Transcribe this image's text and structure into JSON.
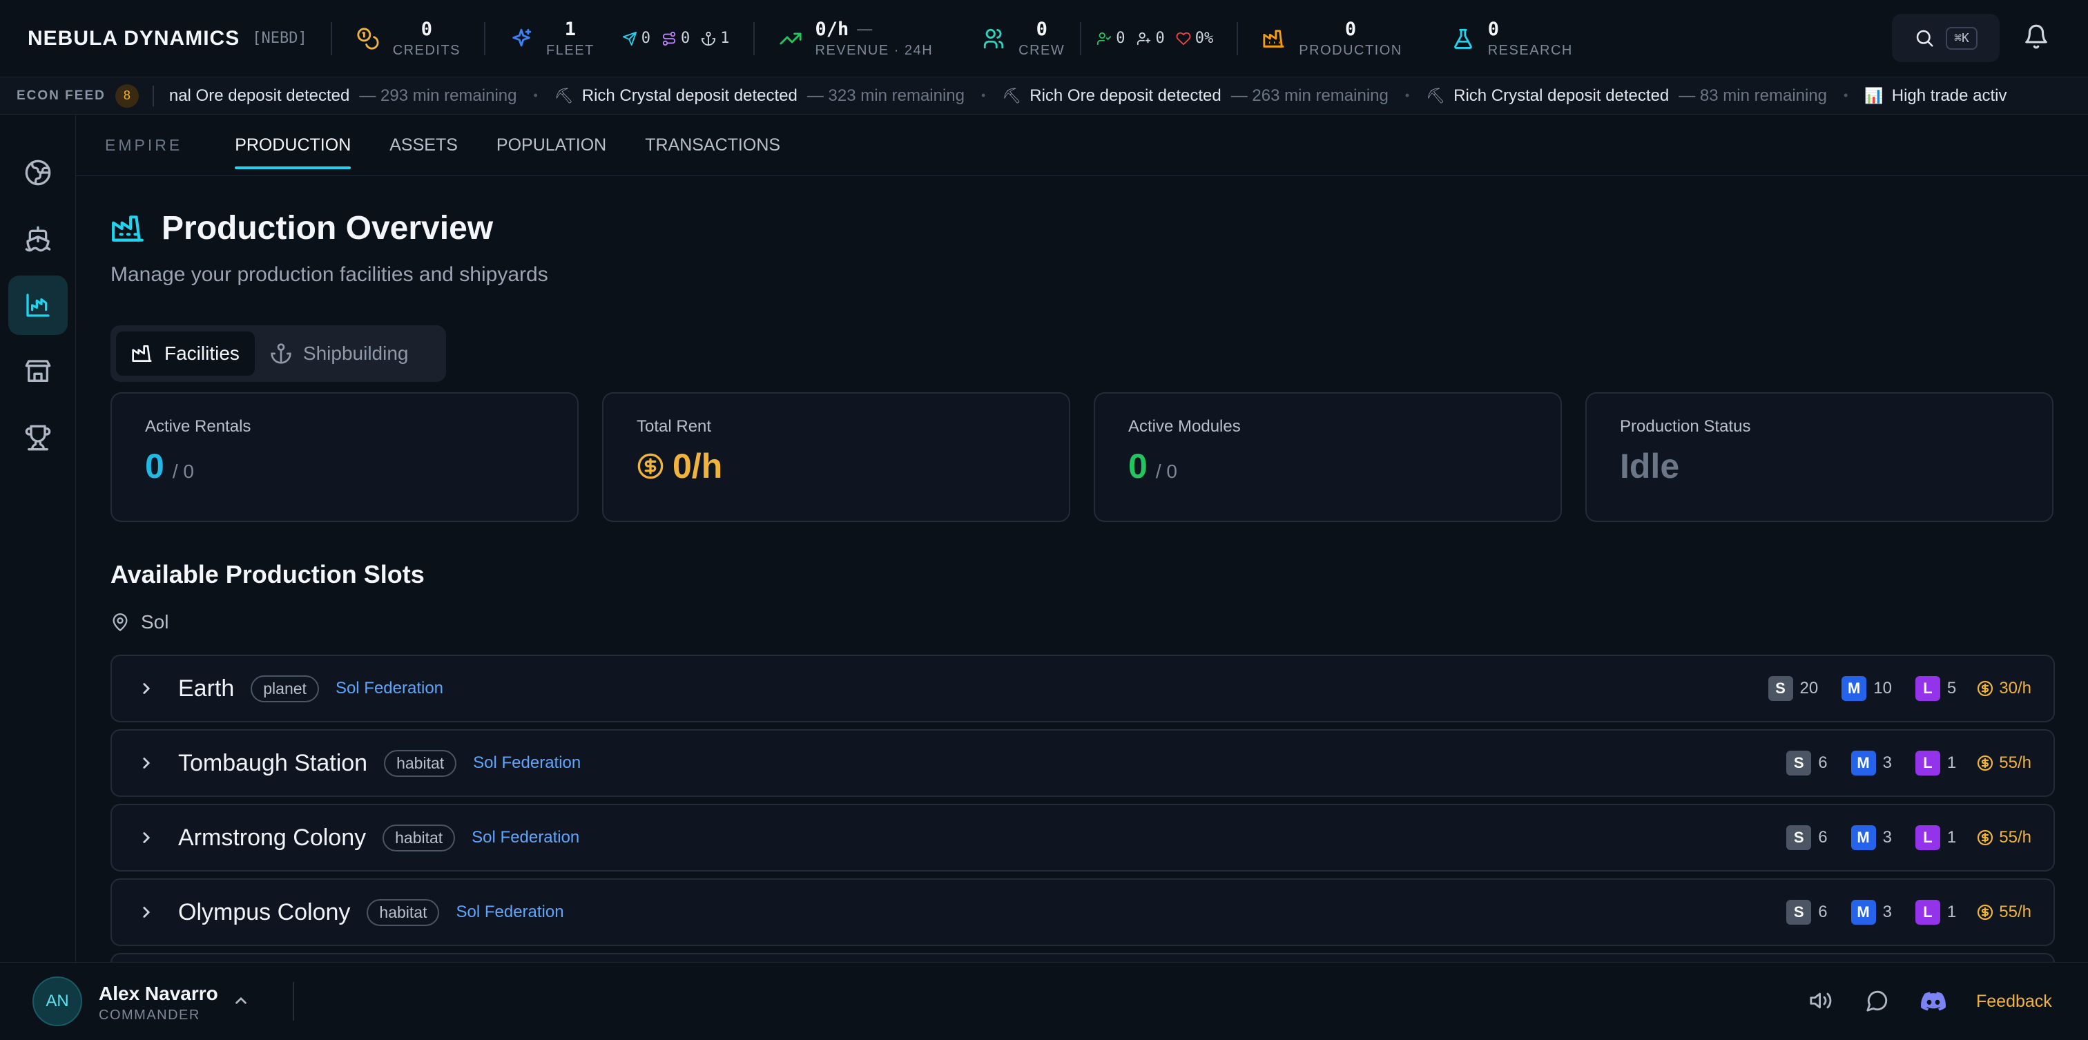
{
  "brand": {
    "name": "NEBULA DYNAMICS",
    "tag": "[NEBD]"
  },
  "stats": {
    "credits": {
      "value": "0",
      "label": "CREDITS"
    },
    "fleet": {
      "value": "1",
      "label": "FLEET"
    },
    "fleet_detail": {
      "ships_moving": "0",
      "routes": "0",
      "docked": "1"
    },
    "revenue": {
      "value": "0/h",
      "trend": "—",
      "label": "REVENUE · 24H"
    },
    "crew": {
      "value": "0",
      "label": "CREW"
    },
    "crew_detail": {
      "assigned": "0",
      "unassigned": "0",
      "morale": "0%"
    },
    "production": {
      "value": "0",
      "label": "PRODUCTION"
    },
    "research": {
      "value": "0",
      "label": "RESEARCH"
    }
  },
  "search": {
    "shortcut": "⌘K"
  },
  "ticker": {
    "label": "ECON FEED",
    "count": "8",
    "items": [
      {
        "text": "nal Ore deposit detected",
        "sub": "— 293 min remaining",
        "icon": ""
      },
      {
        "text": "Rich Crystal deposit detected",
        "sub": "— 323 min remaining",
        "icon": "⛏"
      },
      {
        "text": "Rich Ore deposit detected",
        "sub": "— 263 min remaining",
        "icon": "⛏"
      },
      {
        "text": "Rich Crystal deposit detected",
        "sub": "— 83 min remaining",
        "icon": "⛏"
      },
      {
        "text": "High trade activ",
        "sub": "",
        "icon": "📊"
      }
    ]
  },
  "tabs": {
    "section": "EMPIRE",
    "items": [
      "PRODUCTION",
      "ASSETS",
      "POPULATION",
      "TRANSACTIONS"
    ],
    "active": "PRODUCTION"
  },
  "page": {
    "title": "Production Overview",
    "subtitle": "Manage your production facilities and shipyards"
  },
  "segment": {
    "facilities": "Facilities",
    "shipbuilding": "Shipbuilding",
    "active": "Facilities"
  },
  "cards": [
    {
      "label": "Active Rentals",
      "value": "0",
      "of": "/ 0",
      "color": "#22b8e6"
    },
    {
      "label": "Total Rent",
      "value": "0/h",
      "of": "",
      "color": "#f0b43c"
    },
    {
      "label": "Active Modules",
      "value": "0",
      "of": "/ 0",
      "color": "#22c55e"
    },
    {
      "label": "Production Status",
      "value": "Idle",
      "of": "",
      "color": "#6b7686"
    }
  ],
  "slots_section": {
    "title": "Available Production Slots",
    "system": "Sol"
  },
  "locations": [
    {
      "name": "Earth",
      "type": "planet",
      "faction": "Sol Federation",
      "s": "20",
      "m": "10",
      "l": "5",
      "rate": "30/h"
    },
    {
      "name": "Tombaugh Station",
      "type": "habitat",
      "faction": "Sol Federation",
      "s": "6",
      "m": "3",
      "l": "1",
      "rate": "55/h"
    },
    {
      "name": "Armstrong Colony",
      "type": "habitat",
      "faction": "Sol Federation",
      "s": "6",
      "m": "3",
      "l": "1",
      "rate": "55/h"
    },
    {
      "name": "Olympus Colony",
      "type": "habitat",
      "faction": "Sol Federation",
      "s": "6",
      "m": "3",
      "l": "1",
      "rate": "55/h"
    }
  ],
  "size_labels": {
    "s": "S",
    "m": "M",
    "l": "L"
  },
  "user": {
    "initials": "AN",
    "name": "Alex Navarro",
    "role": "COMMANDER"
  },
  "footer": {
    "feedback": "Feedback"
  },
  "colors": {
    "accent": "#22d3ee",
    "gold": "#f0b43c",
    "faction": "#60a5fa",
    "background": "#0b1119"
  }
}
